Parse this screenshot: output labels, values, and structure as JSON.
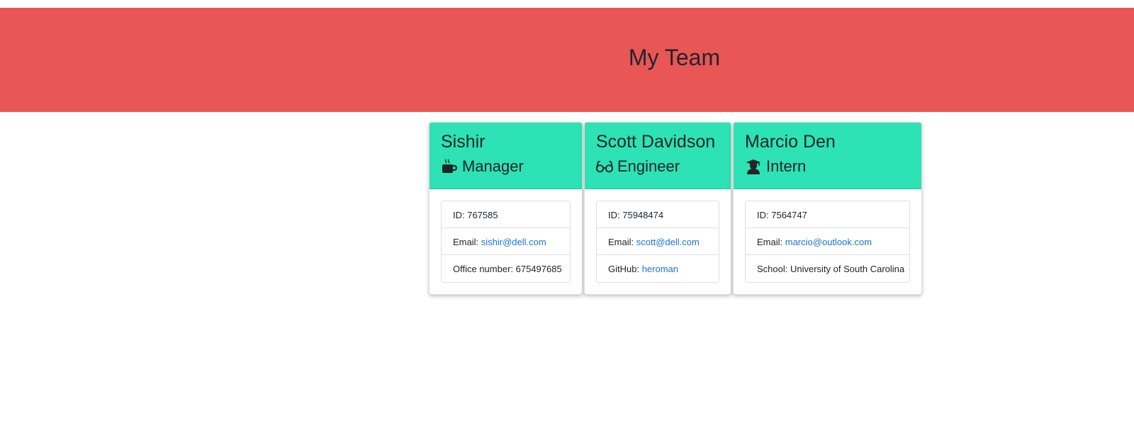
{
  "header": {
    "title": "My Team"
  },
  "team": [
    {
      "name": "Sishir",
      "role": "Manager",
      "role_icon": "mug-icon",
      "id_label": "ID: ",
      "id": "767585",
      "email_label": "Email: ",
      "email": "sishir@dell.com",
      "extra_label": "Office number: ",
      "extra_value": "675497685",
      "extra_is_link": false
    },
    {
      "name": "Scott Davidson",
      "role": "Engineer",
      "role_icon": "glasses-icon",
      "id_label": "ID: ",
      "id": "75948474",
      "email_label": "Email: ",
      "email": "scott@dell.com",
      "extra_label": "GitHub: ",
      "extra_value": "heroman",
      "extra_is_link": true
    },
    {
      "name": "Marcio Den",
      "role": "Intern",
      "role_icon": "graduate-icon",
      "id_label": "ID: ",
      "id": "7564747",
      "email_label": "Email: ",
      "email": "marcio@outlook.com",
      "extra_label": "School: ",
      "extra_value": "University of South Carolina",
      "extra_is_link": false
    }
  ],
  "colors": {
    "header_bg": "#e85656",
    "card_header_bg": "#2de2b4",
    "link": "#1a73d9"
  }
}
